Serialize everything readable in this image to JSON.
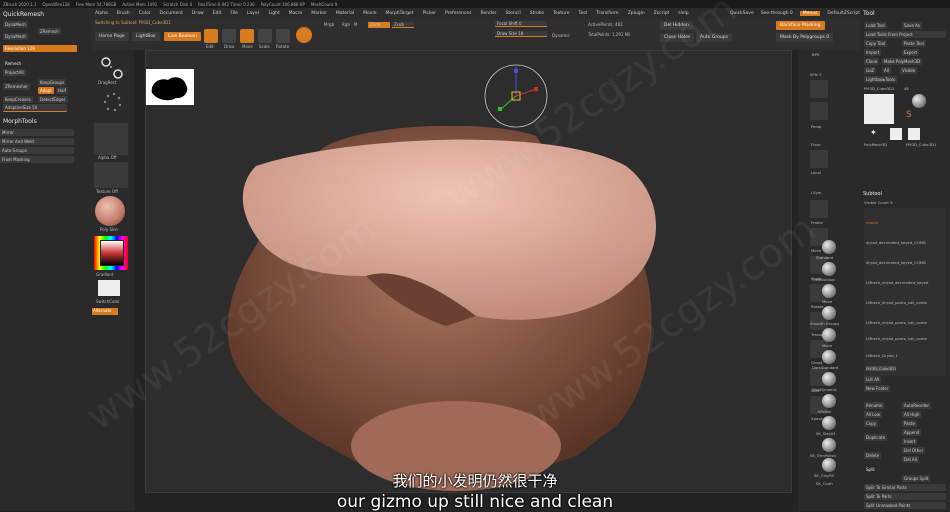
{
  "titlebar": {
    "app": "ZBrush 2020.1.1",
    "items": [
      "ZBrush 2020.1.1",
      "OpenWire128",
      "Free Mem 54.786GB",
      "Active Mem 1491",
      "Scratch Disk 0",
      "RealTime 0.042 Timer 0.236",
      "PolyCount 306.868 KP",
      "MeshCount 9"
    ]
  },
  "menu": {
    "items": [
      "Alpha",
      "Brush",
      "Color",
      "Document",
      "Draw",
      "Edit",
      "File",
      "Layer",
      "Light",
      "Macro",
      "Marker",
      "Material",
      "Movie",
      "MorphTarget",
      "Picker",
      "Preferences",
      "Render",
      "Stencil",
      "Stroke",
      "Texture",
      "Tool",
      "Transform",
      "Zplugin",
      "Zscript",
      "Help"
    ],
    "quicksave": "QuickSave",
    "seethrough": "See-through 0",
    "menus": "Menus",
    "defaultzscript": "DefaultZScript"
  },
  "leftpanel": {
    "quickremesh": "QuickRemesh",
    "dynamesh": "DynaMesh",
    "zremesh": "ZRemesh",
    "dynamesh_btn": "DynaMesh",
    "resolution": "Resolution 128",
    "remesh": "Remesh",
    "project_all": "ProjectAll",
    "zremesher": "ZRemesher",
    "keep_groups": "KeepGroups",
    "adapt": "Adapt",
    "half": "Half",
    "keep_creases": "KeepCreases",
    "detect_edges": "DetectEdges",
    "adaptive_size": "AdaptiveSize 50",
    "morphtools": "MorphTools",
    "mirror": "Mirror",
    "mirror_and_weld": "Mirror And Weld",
    "auto_groups": "Auto Groups",
    "from_masking": "From Masking"
  },
  "topshelf": {
    "switching_text": "Switching to Subtool: PM3D_Cube3D1",
    "home_page": "Home Page",
    "lightbox": "LightBox",
    "live_boolean": "Live Boolean",
    "edit": "Edit",
    "draw": "Draw",
    "move": "Move",
    "scale": "Scale",
    "rotate": "Rotate",
    "mrgb": "Mrgb",
    "rgb": "Rgb",
    "m": "M",
    "zadd": "Zadd",
    "zsub": "Zsub",
    "focal_shift": "Focal Shift 0",
    "draw_size": "Draw Size 18",
    "dynamic": "Dynamic",
    "active_points": "ActivePoints: 482",
    "total_points": "TotalPoints: 1,291 Mil",
    "del_hidden": "Del Hidden",
    "close_holes": "Close Holes",
    "auto_groups": "Auto Groups"
  },
  "leftshelf": {
    "stroke_label": "DragRect",
    "alpha_label": "Alpha Off",
    "texture_label": "Texture Off",
    "material_label": "Poly Skin",
    "gradient": "Gradient",
    "switch_color": "SwitchColor",
    "alternate": "Alternate"
  },
  "rightshelf": {
    "items": [
      "BPR",
      "SPix 3",
      "Persp",
      "Floor",
      "Local",
      "LSym",
      "Frame",
      "Move",
      "Scale",
      "Rotate",
      "Transp",
      "Ghost",
      "Solo",
      "Xpose"
    ]
  },
  "rightpanel": {
    "tool_title": "Tool",
    "load_tool": "Load Tool",
    "save_as": "Save As",
    "load_tools_from_project": "Load Tools From Project",
    "copy_tool": "Copy Tool",
    "paste_tool": "Paste Tool",
    "import": "Import",
    "export": "Export",
    "clone": "Clone",
    "make_polymesh": "Make PolyMesh3D",
    "goz": "GoZ",
    "all": "All",
    "visible": "Visible",
    "lightbox_tools": "Lightbox▸Tools",
    "current_tool": "PM3D_Cube3D1",
    "tool_count": "48",
    "thumbs": [
      "PM3D_Cube3D1",
      "SphereBrush",
      "SimpleBrush",
      "PolyMesh3D",
      "PM3D_Cube3D1",
      "PM3D_Cube3D1"
    ],
    "subtool": "Subtool",
    "visible_count": "Visible Count 9",
    "subtools": [
      "mouth",
      "dryad_decimated_keyed_COMB",
      "dryad_decimated_keyed_COMB",
      "Ulfbeck_dryad_decimated_keyed",
      "Ulfbeck_dryad_panto_sdk_comb",
      "Ulfbeck_dryad_panto_sdk_comb",
      "Ulfbeck_dryad_panto_sdk_comb",
      "Ulfbeck_Dryad_1",
      "PM3D_Cube3D1"
    ],
    "list_all": "List All",
    "new_folder": "New Folder",
    "rename": "Rename",
    "auto_reorder": "AutoReorder",
    "all_low": "All Low",
    "all_high": "All High",
    "copy": "Copy",
    "paste": "Paste",
    "append": "Append",
    "duplicate": "Duplicate",
    "insert": "Insert",
    "del_other": "Del Other",
    "delete": "Delete",
    "del_all": "Del All",
    "split": "Split",
    "groups_split": "Groups Split",
    "split_to_similar_parts": "Split To Similar Parts",
    "split_to_parts": "Split To Parts",
    "split_unmasked_points": "Split Unmasked Points",
    "backface_masking": "Backface Masking",
    "mask_by_polygroups": "Mask By Polygroups 0"
  },
  "viewport": {
    "point_label": "P:0218"
  },
  "materials": [
    "Standard",
    "ClayBuildup",
    "Move",
    "Smooth Groups",
    "Move",
    "DamStandard",
    "TrimDynamic",
    "hPolish",
    "SK_Slash3",
    "SK_TrimPolish",
    "SK_ClayFill",
    "SK_Cloth"
  ],
  "subtitle": {
    "cn": "我们的小发明仍然很干净",
    "en": "our gizmo up still nice and clean"
  },
  "watermark": "www.52cgzy.com",
  "colors": {
    "accent": "#d87a1e",
    "skin": "#d9a08f",
    "clay": "#8a5a48"
  }
}
